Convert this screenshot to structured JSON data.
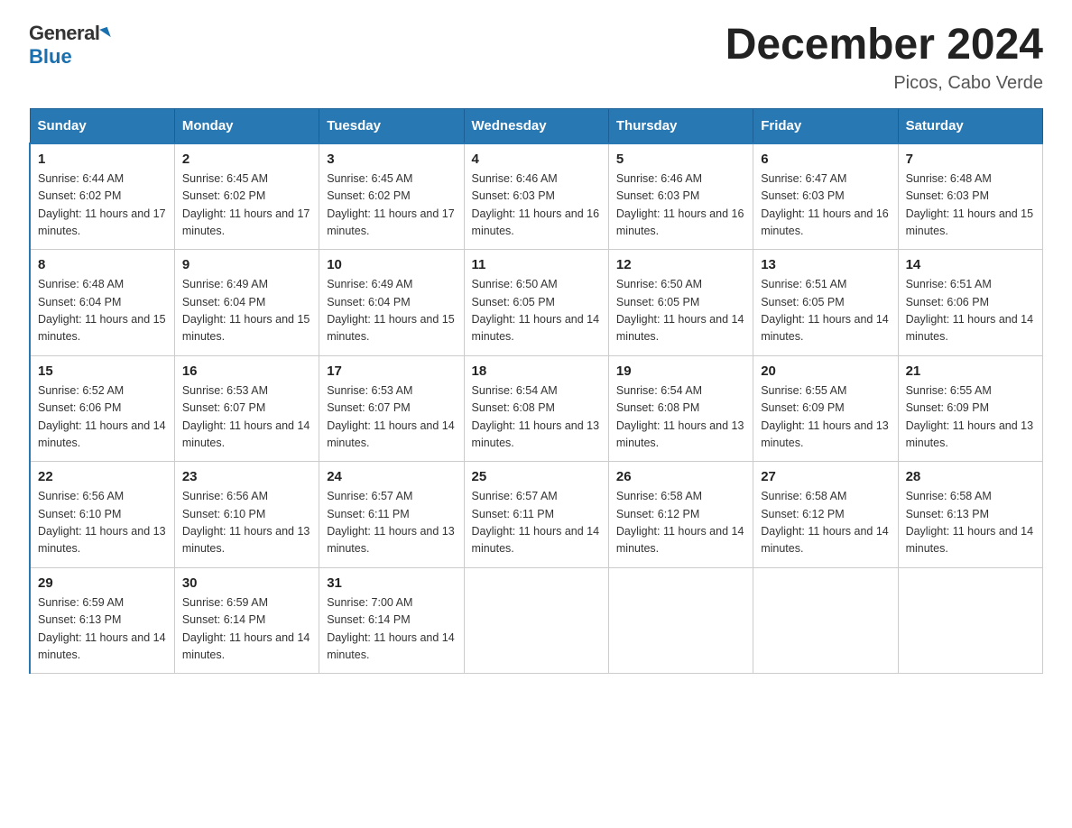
{
  "logo": {
    "general": "General",
    "blue": "Blue"
  },
  "title": "December 2024",
  "subtitle": "Picos, Cabo Verde",
  "days_of_week": [
    "Sunday",
    "Monday",
    "Tuesday",
    "Wednesday",
    "Thursday",
    "Friday",
    "Saturday"
  ],
  "weeks": [
    [
      {
        "num": "1",
        "sunrise": "6:44 AM",
        "sunset": "6:02 PM",
        "daylight": "11 hours and 17 minutes."
      },
      {
        "num": "2",
        "sunrise": "6:45 AM",
        "sunset": "6:02 PM",
        "daylight": "11 hours and 17 minutes."
      },
      {
        "num": "3",
        "sunrise": "6:45 AM",
        "sunset": "6:02 PM",
        "daylight": "11 hours and 17 minutes."
      },
      {
        "num": "4",
        "sunrise": "6:46 AM",
        "sunset": "6:03 PM",
        "daylight": "11 hours and 16 minutes."
      },
      {
        "num": "5",
        "sunrise": "6:46 AM",
        "sunset": "6:03 PM",
        "daylight": "11 hours and 16 minutes."
      },
      {
        "num": "6",
        "sunrise": "6:47 AM",
        "sunset": "6:03 PM",
        "daylight": "11 hours and 16 minutes."
      },
      {
        "num": "7",
        "sunrise": "6:48 AM",
        "sunset": "6:03 PM",
        "daylight": "11 hours and 15 minutes."
      }
    ],
    [
      {
        "num": "8",
        "sunrise": "6:48 AM",
        "sunset": "6:04 PM",
        "daylight": "11 hours and 15 minutes."
      },
      {
        "num": "9",
        "sunrise": "6:49 AM",
        "sunset": "6:04 PM",
        "daylight": "11 hours and 15 minutes."
      },
      {
        "num": "10",
        "sunrise": "6:49 AM",
        "sunset": "6:04 PM",
        "daylight": "11 hours and 15 minutes."
      },
      {
        "num": "11",
        "sunrise": "6:50 AM",
        "sunset": "6:05 PM",
        "daylight": "11 hours and 14 minutes."
      },
      {
        "num": "12",
        "sunrise": "6:50 AM",
        "sunset": "6:05 PM",
        "daylight": "11 hours and 14 minutes."
      },
      {
        "num": "13",
        "sunrise": "6:51 AM",
        "sunset": "6:05 PM",
        "daylight": "11 hours and 14 minutes."
      },
      {
        "num": "14",
        "sunrise": "6:51 AM",
        "sunset": "6:06 PM",
        "daylight": "11 hours and 14 minutes."
      }
    ],
    [
      {
        "num": "15",
        "sunrise": "6:52 AM",
        "sunset": "6:06 PM",
        "daylight": "11 hours and 14 minutes."
      },
      {
        "num": "16",
        "sunrise": "6:53 AM",
        "sunset": "6:07 PM",
        "daylight": "11 hours and 14 minutes."
      },
      {
        "num": "17",
        "sunrise": "6:53 AM",
        "sunset": "6:07 PM",
        "daylight": "11 hours and 14 minutes."
      },
      {
        "num": "18",
        "sunrise": "6:54 AM",
        "sunset": "6:08 PM",
        "daylight": "11 hours and 13 minutes."
      },
      {
        "num": "19",
        "sunrise": "6:54 AM",
        "sunset": "6:08 PM",
        "daylight": "11 hours and 13 minutes."
      },
      {
        "num": "20",
        "sunrise": "6:55 AM",
        "sunset": "6:09 PM",
        "daylight": "11 hours and 13 minutes."
      },
      {
        "num": "21",
        "sunrise": "6:55 AM",
        "sunset": "6:09 PM",
        "daylight": "11 hours and 13 minutes."
      }
    ],
    [
      {
        "num": "22",
        "sunrise": "6:56 AM",
        "sunset": "6:10 PM",
        "daylight": "11 hours and 13 minutes."
      },
      {
        "num": "23",
        "sunrise": "6:56 AM",
        "sunset": "6:10 PM",
        "daylight": "11 hours and 13 minutes."
      },
      {
        "num": "24",
        "sunrise": "6:57 AM",
        "sunset": "6:11 PM",
        "daylight": "11 hours and 13 minutes."
      },
      {
        "num": "25",
        "sunrise": "6:57 AM",
        "sunset": "6:11 PM",
        "daylight": "11 hours and 14 minutes."
      },
      {
        "num": "26",
        "sunrise": "6:58 AM",
        "sunset": "6:12 PM",
        "daylight": "11 hours and 14 minutes."
      },
      {
        "num": "27",
        "sunrise": "6:58 AM",
        "sunset": "6:12 PM",
        "daylight": "11 hours and 14 minutes."
      },
      {
        "num": "28",
        "sunrise": "6:58 AM",
        "sunset": "6:13 PM",
        "daylight": "11 hours and 14 minutes."
      }
    ],
    [
      {
        "num": "29",
        "sunrise": "6:59 AM",
        "sunset": "6:13 PM",
        "daylight": "11 hours and 14 minutes."
      },
      {
        "num": "30",
        "sunrise": "6:59 AM",
        "sunset": "6:14 PM",
        "daylight": "11 hours and 14 minutes."
      },
      {
        "num": "31",
        "sunrise": "7:00 AM",
        "sunset": "6:14 PM",
        "daylight": "11 hours and 14 minutes."
      },
      null,
      null,
      null,
      null
    ]
  ]
}
